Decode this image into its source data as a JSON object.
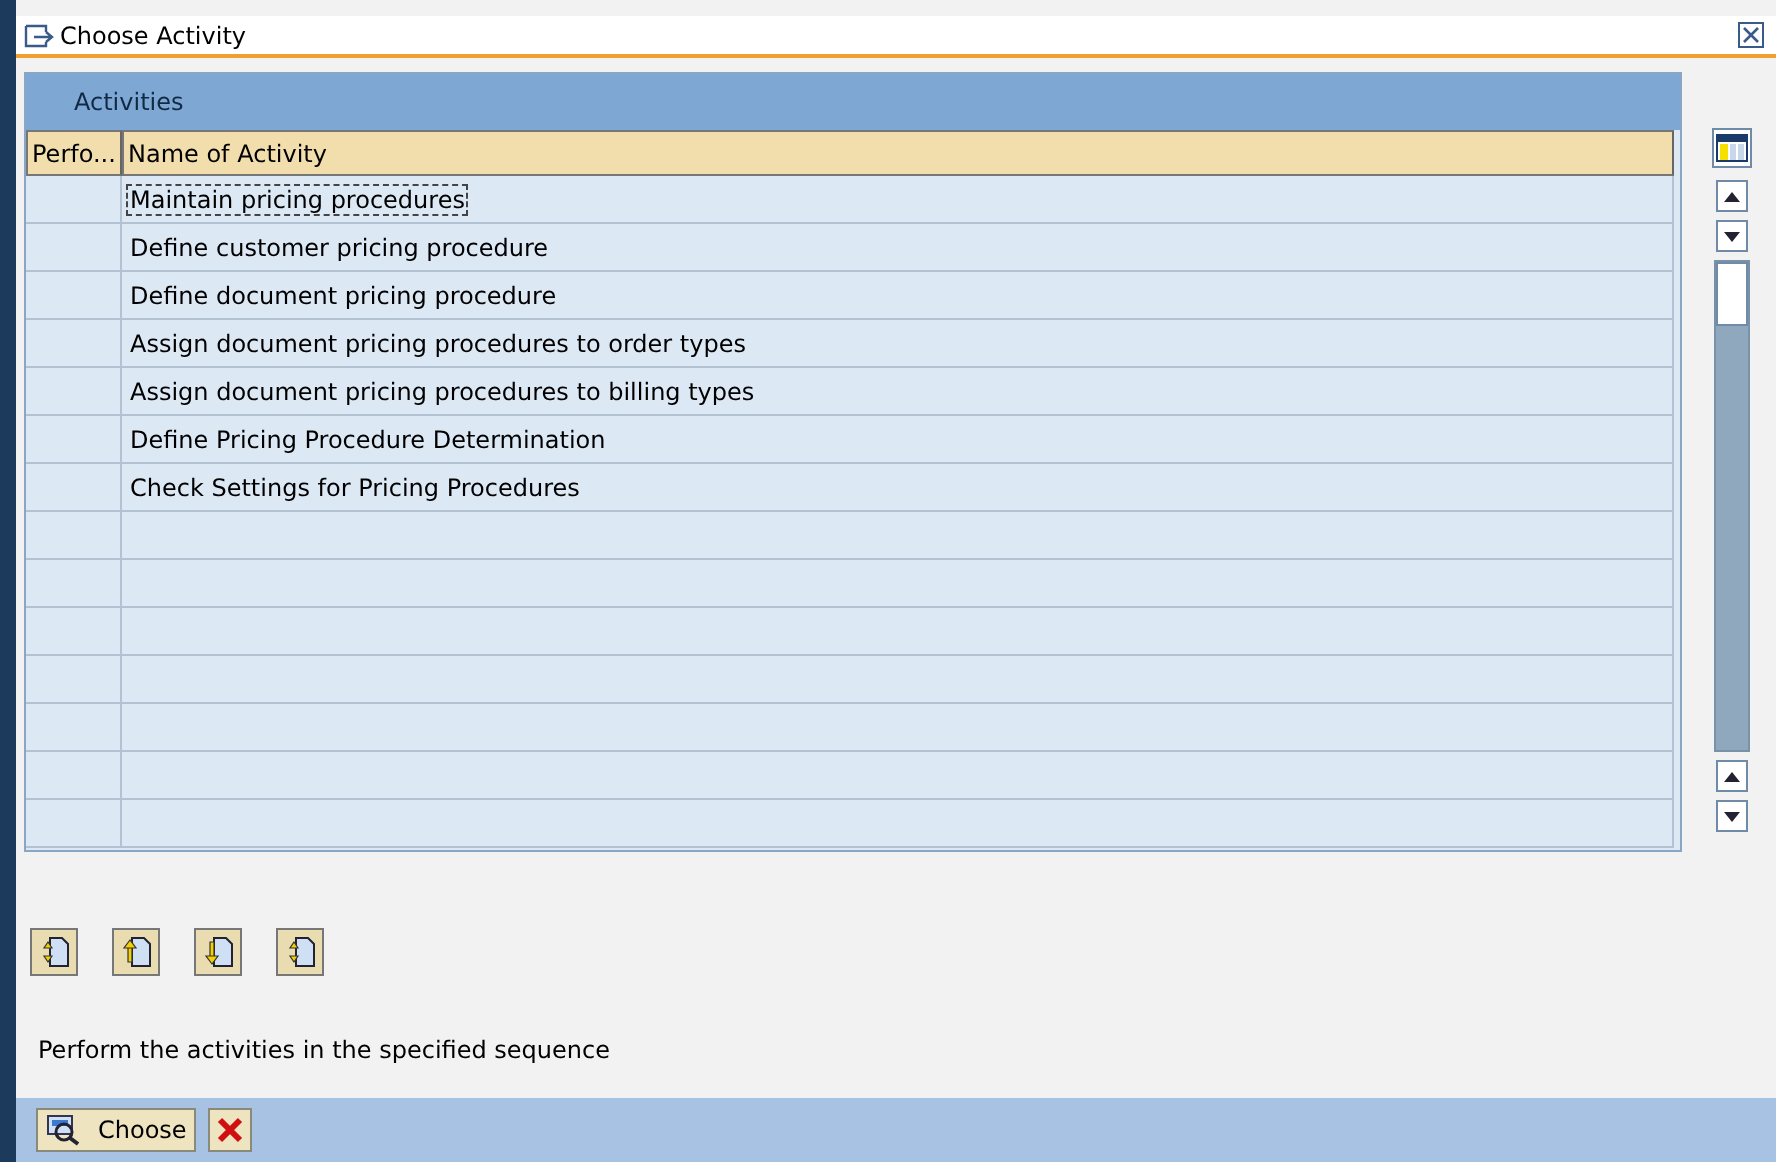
{
  "window": {
    "title": "Choose Activity"
  },
  "table": {
    "title": "Activities",
    "columns": [
      "Perfo...",
      "Name of Activity"
    ],
    "rows": [
      {
        "cells": [
          "",
          "Maintain pricing procedures"
        ],
        "focused": true
      },
      {
        "cells": [
          "",
          "Define customer pricing procedure"
        ],
        "focused": false
      },
      {
        "cells": [
          "",
          "Define document pricing procedure"
        ],
        "focused": false
      },
      {
        "cells": [
          "",
          "Assign document pricing procedures to order types"
        ],
        "focused": false
      },
      {
        "cells": [
          "",
          "Assign document pricing procedures to billing types"
        ],
        "focused": false
      },
      {
        "cells": [
          "",
          "Define Pricing Procedure Determination"
        ],
        "focused": false
      },
      {
        "cells": [
          "",
          "Check Settings for Pricing Procedures"
        ],
        "focused": false
      }
    ]
  },
  "hint": "Perform the activities in the specified sequence",
  "footer": {
    "buttons": [
      {
        "kind": "choose",
        "label": "Choose"
      },
      {
        "kind": "cancel"
      }
    ]
  }
}
